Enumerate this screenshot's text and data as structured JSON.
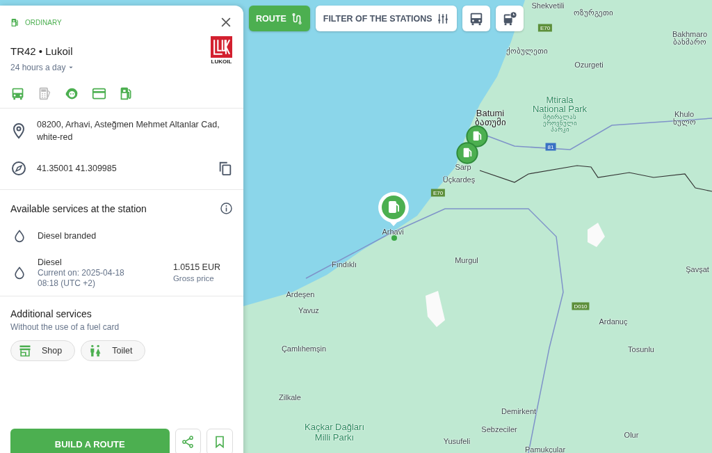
{
  "station_panel": {
    "category": "ORDINARY",
    "title": "TR42 • Lukoil",
    "hours": "24 hours a day",
    "logo_text": "LUKOIL",
    "features": [
      {
        "kind": "truck",
        "available": true
      },
      {
        "kind": "terminal",
        "available": false
      },
      {
        "kind": "support",
        "available": true
      },
      {
        "kind": "card",
        "available": true
      },
      {
        "kind": "fuel",
        "available": true
      }
    ],
    "address": "08200, Arhavi, Asteğmen Mehmet Altanlar Cad, white-red",
    "coordinates": "41.35001 41.309985",
    "services_title": "Available services at the station",
    "fuels": [
      {
        "name": "Diesel branded"
      },
      {
        "name": "Diesel",
        "updated": "Current on: 2025-04-18 08:18 (UTC +2)",
        "price": "1.0515 EUR",
        "price_note": "Gross price"
      }
    ],
    "additional_title": "Additional services",
    "additional_subtitle": "Without the use of a fuel card",
    "chips": [
      {
        "kind": "shop",
        "label": "Shop"
      },
      {
        "kind": "toilet",
        "label": "Toilet"
      }
    ],
    "build_route": "BUILD A ROUTE"
  },
  "toolbar": {
    "route": "ROUTE",
    "filter": "FILTER OF THE STATIONS"
  },
  "map": {
    "labels": [
      {
        "text": "Shekvetili",
        "kind": "place"
      },
      {
        "text": "ოზურგეთი",
        "kind": "place"
      },
      {
        "text": "E70",
        "kind": "road"
      },
      {
        "text": "ქობულეთი",
        "kind": "place"
      },
      {
        "text": "Ozurgeti",
        "kind": "place"
      },
      {
        "text": "Bakhmaro",
        "kind": "place"
      },
      {
        "text": "ბახმარო",
        "kind": "place"
      },
      {
        "text": "Mtirala",
        "kind": "park"
      },
      {
        "text": "National Park",
        "kind": "park"
      },
      {
        "text": "მტირალას",
        "kind": "park-small"
      },
      {
        "text": "ეროვნული",
        "kind": "park-small"
      },
      {
        "text": "პარკი",
        "kind": "park-small"
      },
      {
        "text": "Batumi",
        "kind": "city"
      },
      {
        "text": "ბათუმი",
        "kind": "city"
      },
      {
        "text": "Khulo",
        "kind": "place"
      },
      {
        "text": "ხულო",
        "kind": "place"
      },
      {
        "text": "81",
        "kind": "road-blue"
      },
      {
        "text": "Sarp",
        "kind": "place"
      },
      {
        "text": "Üçkardeş",
        "kind": "place"
      },
      {
        "text": "E70",
        "kind": "road"
      },
      {
        "text": "Arhavi",
        "kind": "place"
      },
      {
        "text": "Fındıklı",
        "kind": "place"
      },
      {
        "text": "Murgul",
        "kind": "place"
      },
      {
        "text": "Şavşat",
        "kind": "place"
      },
      {
        "text": "Ardeşen",
        "kind": "place"
      },
      {
        "text": "Yavuz",
        "kind": "place"
      },
      {
        "text": "D010",
        "kind": "road"
      },
      {
        "text": "Ardanuç",
        "kind": "place"
      },
      {
        "text": "Çamlıhemşin",
        "kind": "place"
      },
      {
        "text": "Tosunlu",
        "kind": "place"
      },
      {
        "text": "Zilkale",
        "kind": "place"
      },
      {
        "text": "Kaçkar Dağları",
        "kind": "park"
      },
      {
        "text": "Milli Parkı",
        "kind": "park"
      },
      {
        "text": "Demirkent",
        "kind": "place"
      },
      {
        "text": "Sebzeciler",
        "kind": "place"
      },
      {
        "text": "Olur",
        "kind": "place"
      },
      {
        "text": "Yusufeli",
        "kind": "place"
      },
      {
        "text": "Pamukçular",
        "kind": "place"
      }
    ],
    "stations": [
      {
        "selected": true
      },
      {
        "selected": false
      },
      {
        "selected": false
      }
    ]
  }
}
